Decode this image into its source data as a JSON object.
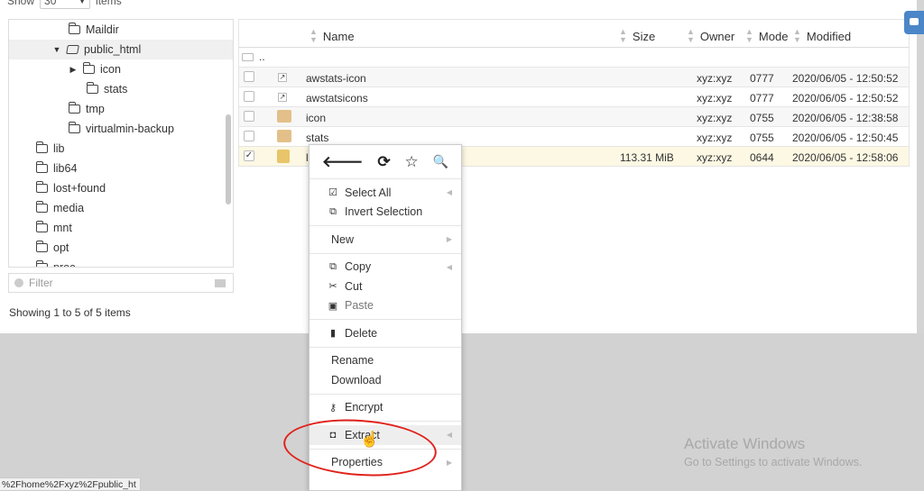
{
  "show": {
    "label": "Show",
    "value": "30",
    "suffix": "items"
  },
  "tree": {
    "items": [
      {
        "label": "Maildir"
      },
      {
        "label": "public_html"
      },
      {
        "label": "icon"
      },
      {
        "label": "stats"
      },
      {
        "label": "tmp"
      },
      {
        "label": "virtualmin-backup"
      },
      {
        "label": "lib"
      },
      {
        "label": "lib64"
      },
      {
        "label": "lost+found"
      },
      {
        "label": "media"
      },
      {
        "label": "mnt"
      },
      {
        "label": "opt"
      },
      {
        "label": "proc"
      }
    ]
  },
  "filter": {
    "placeholder": "Filter"
  },
  "showing_text": "Showing 1 to 5 of 5 items",
  "table": {
    "headers": {
      "name": "Name",
      "size": "Size",
      "owner": "Owner",
      "mode": "Mode",
      "modified": "Modified"
    },
    "up_label": "..",
    "rows": [
      {
        "name": "awstats-icon",
        "size": "",
        "owner": "xyz:xyz",
        "mode": "0777",
        "modified": "2020/06/05 - 12:50:52"
      },
      {
        "name": "awstatsicons",
        "size": "",
        "owner": "xyz:xyz",
        "mode": "0777",
        "modified": "2020/06/05 - 12:50:52"
      },
      {
        "name": "icon",
        "size": "",
        "owner": "xyz:xyz",
        "mode": "0755",
        "modified": "2020/06/05 - 12:38:58"
      },
      {
        "name": "stats",
        "size": "",
        "owner": "xyz:xyz",
        "mode": "0755",
        "modified": "2020/06/05 - 12:50:45"
      },
      {
        "name": "l",
        "size": "113.31 MiB",
        "owner": "xyz:xyz",
        "mode": "0644",
        "modified": "2020/06/05 - 12:58:06"
      }
    ]
  },
  "context_menu": {
    "tools": {
      "back": "🡐",
      "refresh": "⟳",
      "favorite": "☆",
      "search": "🔍"
    },
    "select_all": "Select All",
    "invert_selection": "Invert Selection",
    "new": "New",
    "copy": "Copy",
    "cut": "Cut",
    "paste": "Paste",
    "delete": "Delete",
    "rename": "Rename",
    "download": "Download",
    "encrypt": "Encrypt",
    "extract": "Extract",
    "properties": "Properties"
  },
  "watermark": {
    "line1": "Activate Windows",
    "line2": "Go to Settings to activate Windows."
  },
  "status_url": "%2Fhome%2Fxyz%2Fpublic_ht",
  "colors": {
    "highlight_row": "#fcf8e3",
    "annotation": "#e0221c",
    "accent": "#4a86c8"
  }
}
